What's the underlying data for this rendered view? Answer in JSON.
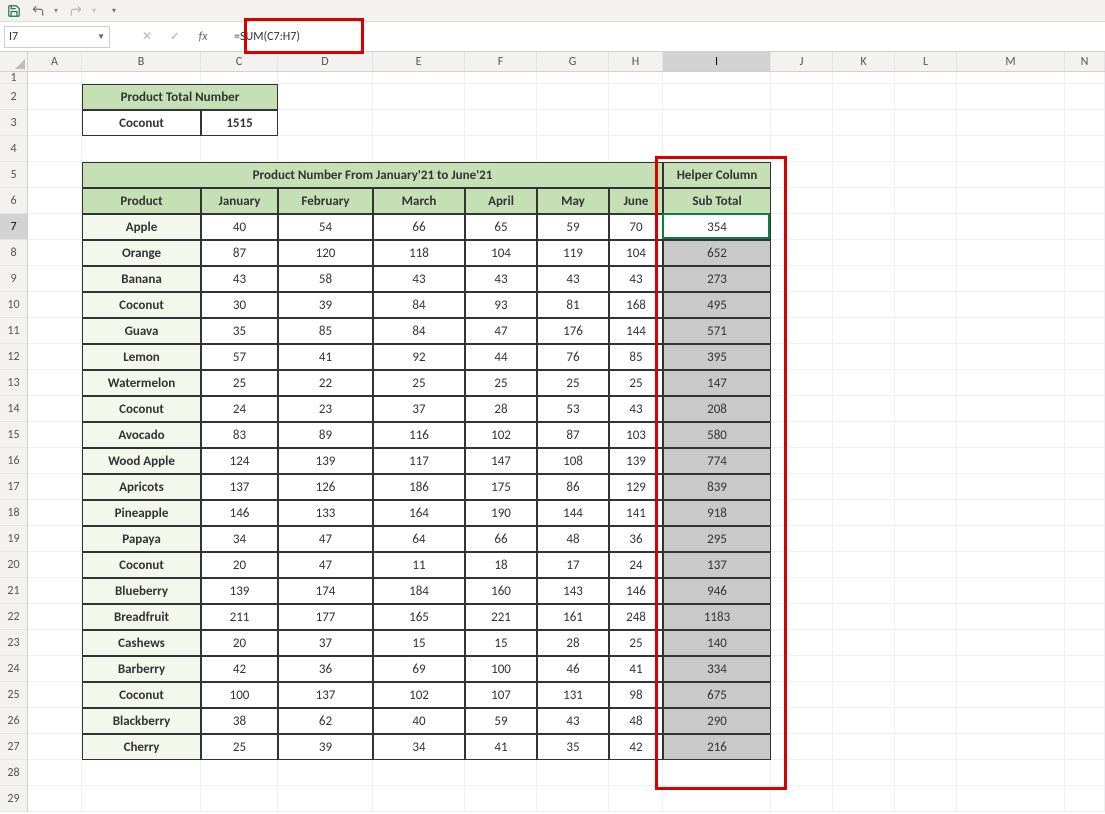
{
  "quick_access": {
    "save_title": "Save",
    "undo_title": "Undo",
    "redo_title": "Redo"
  },
  "namebox": {
    "value": "I7"
  },
  "formula": {
    "prefix": "fx",
    "value": "=SUM(C7:H7)"
  },
  "columns": [
    "A",
    "B",
    "C",
    "D",
    "E",
    "F",
    "G",
    "H",
    "I",
    "J",
    "K",
    "L",
    "M",
    "N"
  ],
  "selected_column": "I",
  "selected_row": 7,
  "summary": {
    "header": "Product Total Number",
    "label": "Coconut",
    "value": "1515"
  },
  "table": {
    "title": "Product Number From January'21 to June'21",
    "headers": [
      "Product",
      "January",
      "February",
      "March",
      "April",
      "May",
      "June"
    ],
    "helper_header": "Helper Column",
    "subtotal_header": "Sub Total",
    "rows": [
      {
        "name": "Apple",
        "v": [
          "40",
          "54",
          "66",
          "65",
          "59",
          "70"
        ],
        "sub": "354"
      },
      {
        "name": "Orange",
        "v": [
          "87",
          "120",
          "118",
          "104",
          "119",
          "104"
        ],
        "sub": "652"
      },
      {
        "name": "Banana",
        "v": [
          "43",
          "58",
          "43",
          "43",
          "43",
          "43"
        ],
        "sub": "273"
      },
      {
        "name": "Coconut",
        "v": [
          "30",
          "39",
          "84",
          "93",
          "81",
          "168"
        ],
        "sub": "495"
      },
      {
        "name": "Guava",
        "v": [
          "35",
          "85",
          "84",
          "47",
          "176",
          "144"
        ],
        "sub": "571"
      },
      {
        "name": "Lemon",
        "v": [
          "57",
          "41",
          "92",
          "44",
          "76",
          "85"
        ],
        "sub": "395"
      },
      {
        "name": "Watermelon",
        "v": [
          "25",
          "22",
          "25",
          "25",
          "25",
          "25"
        ],
        "sub": "147"
      },
      {
        "name": "Coconut",
        "v": [
          "24",
          "23",
          "37",
          "28",
          "53",
          "43"
        ],
        "sub": "208"
      },
      {
        "name": "Avocado",
        "v": [
          "83",
          "89",
          "116",
          "102",
          "87",
          "103"
        ],
        "sub": "580"
      },
      {
        "name": "Wood Apple",
        "v": [
          "124",
          "139",
          "117",
          "147",
          "108",
          "139"
        ],
        "sub": "774"
      },
      {
        "name": "Apricots",
        "v": [
          "137",
          "126",
          "186",
          "175",
          "86",
          "129"
        ],
        "sub": "839"
      },
      {
        "name": "Pineapple",
        "v": [
          "146",
          "133",
          "164",
          "190",
          "144",
          "141"
        ],
        "sub": "918"
      },
      {
        "name": "Papaya",
        "v": [
          "34",
          "47",
          "64",
          "66",
          "48",
          "36"
        ],
        "sub": "295"
      },
      {
        "name": "Coconut",
        "v": [
          "20",
          "47",
          "11",
          "18",
          "17",
          "24"
        ],
        "sub": "137"
      },
      {
        "name": "Blueberry",
        "v": [
          "139",
          "174",
          "184",
          "160",
          "143",
          "146"
        ],
        "sub": "946"
      },
      {
        "name": "Breadfruit",
        "v": [
          "211",
          "177",
          "165",
          "221",
          "161",
          "248"
        ],
        "sub": "1183"
      },
      {
        "name": "Cashews",
        "v": [
          "20",
          "37",
          "15",
          "15",
          "28",
          "25"
        ],
        "sub": "140"
      },
      {
        "name": "Barberry",
        "v": [
          "42",
          "36",
          "69",
          "100",
          "46",
          "41"
        ],
        "sub": "334"
      },
      {
        "name": "Coconut",
        "v": [
          "100",
          "137",
          "102",
          "107",
          "131",
          "98"
        ],
        "sub": "675"
      },
      {
        "name": "Blackberry",
        "v": [
          "38",
          "62",
          "40",
          "59",
          "43",
          "48"
        ],
        "sub": "290"
      },
      {
        "name": "Cherry",
        "v": [
          "25",
          "39",
          "34",
          "41",
          "35",
          "42"
        ],
        "sub": "216"
      }
    ]
  },
  "row_numbers": [
    1,
    2,
    3,
    4,
    5,
    6,
    7,
    8,
    9,
    10,
    11,
    12,
    13,
    14,
    15,
    16,
    17,
    18,
    19,
    20,
    21,
    22,
    23,
    24,
    25,
    26,
    27,
    28,
    29
  ]
}
